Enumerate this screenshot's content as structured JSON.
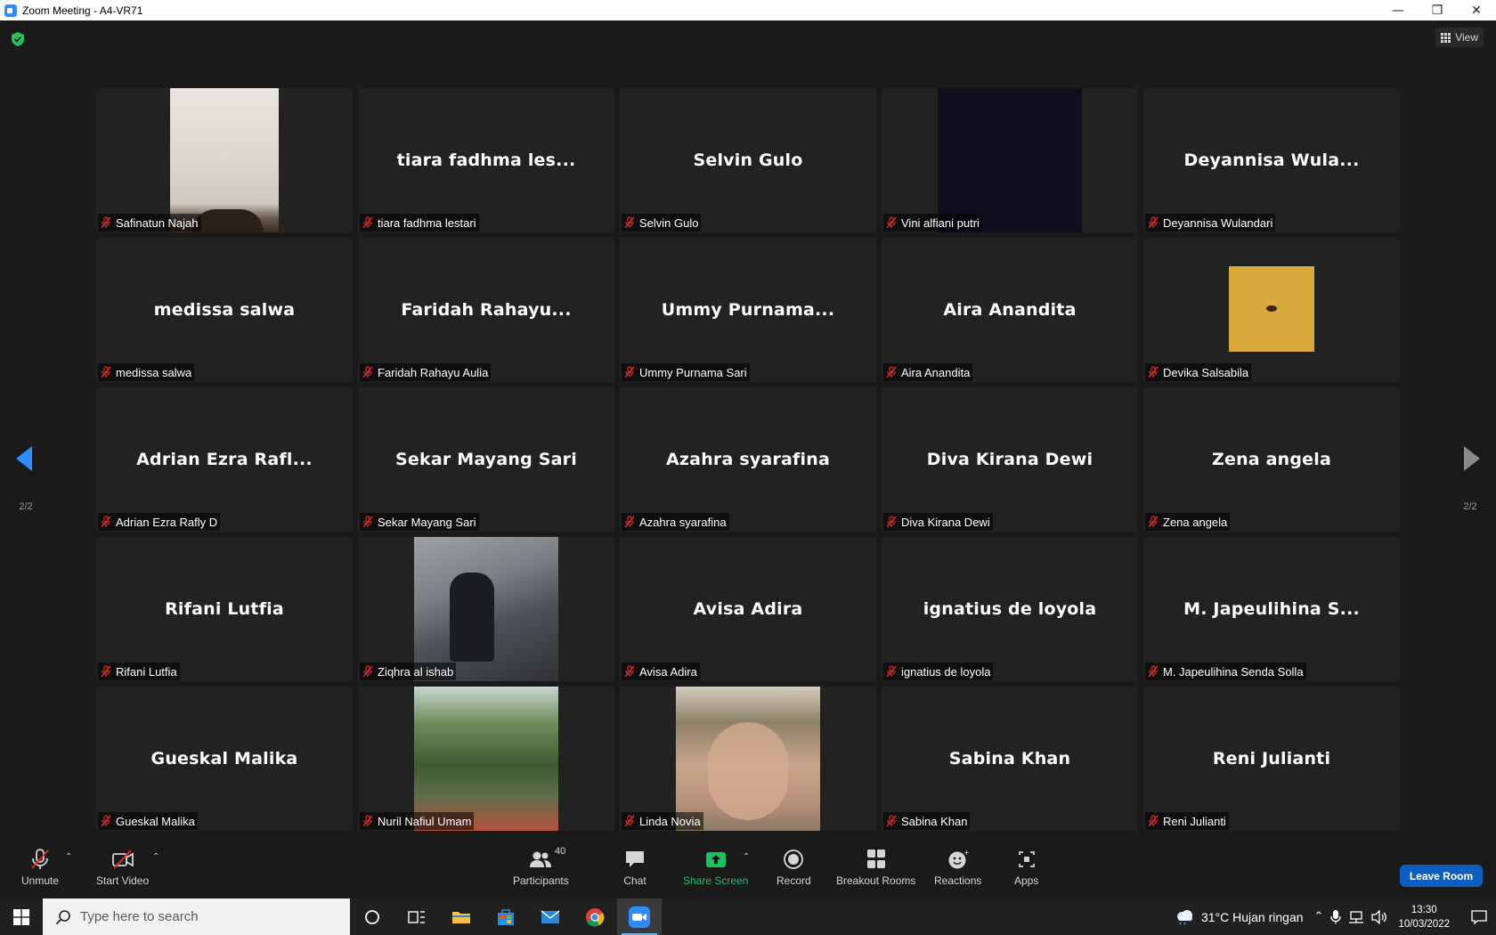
{
  "window": {
    "title": "Zoom Meeting - A4-VR71"
  },
  "top": {
    "view_label": "View"
  },
  "pager": {
    "left_page": "2/2",
    "right_page": "2/2"
  },
  "tiles": [
    {
      "big": "",
      "label": "Safinatun Najah",
      "photo": "safinatun"
    },
    {
      "big": "tiara fadhma les...",
      "label": "tiara fadhma lestari"
    },
    {
      "big": "Selvin Gulo",
      "label": "Selvin Gulo"
    },
    {
      "big": "",
      "label": "Vini alfiani putri",
      "photo": "vini"
    },
    {
      "big": "Deyannisa  Wula...",
      "label": "Deyannisa Wulandari"
    },
    {
      "big": "medissa salwa",
      "label": "medissa salwa"
    },
    {
      "big": "Faridah  Rahayu...",
      "label": "Faridah Rahayu Aulia"
    },
    {
      "big": "Ummy  Purnama...",
      "label": "Ummy Purnama Sari"
    },
    {
      "big": "Aira Anandita",
      "label": "Aira Anandita"
    },
    {
      "big": "",
      "label": "Devika Salsabila",
      "photo": "devika"
    },
    {
      "big": "Adrian  Ezra  Rafl...",
      "label": "Adrian Ezra Rafly D"
    },
    {
      "big": "Sekar Mayang Sari",
      "label": "Sekar Mayang Sari"
    },
    {
      "big": "Azahra syarafina",
      "label": "Azahra syarafina"
    },
    {
      "big": "Diva Kirana Dewi",
      "label": "Diva Kirana Dewi"
    },
    {
      "big": "Zena angela",
      "label": "Zena angela"
    },
    {
      "big": "Rifani Lutfia",
      "label": "Rifani Lutfia"
    },
    {
      "big": "",
      "label": "Ziqhra al ishab",
      "photo": "ziqhra"
    },
    {
      "big": "Avisa Adira",
      "label": "Avisa Adira"
    },
    {
      "big": "ignatius de loyola",
      "label": "ignatius de loyola"
    },
    {
      "big": "M.  Japeulihina  S...",
      "label": "M. Japeulihina Senda Solla"
    },
    {
      "big": "Gueskal Malika",
      "label": "Gueskal Malika"
    },
    {
      "big": "",
      "label": "Nuril Nafiul Umam",
      "photo": "nuril"
    },
    {
      "big": "",
      "label": "Linda Novia",
      "photo": "linda"
    },
    {
      "big": "Sabina Khan",
      "label": "Sabina Khan"
    },
    {
      "big": "Reni Julianti",
      "label": "Reni Julianti"
    }
  ],
  "toolbar": {
    "unmute": "Unmute",
    "start_video": "Start Video",
    "participants": "Participants",
    "participants_count": "40",
    "chat": "Chat",
    "share_screen": "Share Screen",
    "record": "Record",
    "breakout_rooms": "Breakout Rooms",
    "reactions": "Reactions",
    "apps": "Apps",
    "leave": "Leave Room"
  },
  "taskbar": {
    "search_placeholder": "Type here to search",
    "weather": "31°C  Hujan ringan",
    "time": "13:30",
    "date": "10/03/2022"
  },
  "colors": {
    "accent_blue": "#2d8cff",
    "share_green": "#19c160",
    "leave_blue": "#0e5dbf",
    "muted_red": "#e02828"
  }
}
